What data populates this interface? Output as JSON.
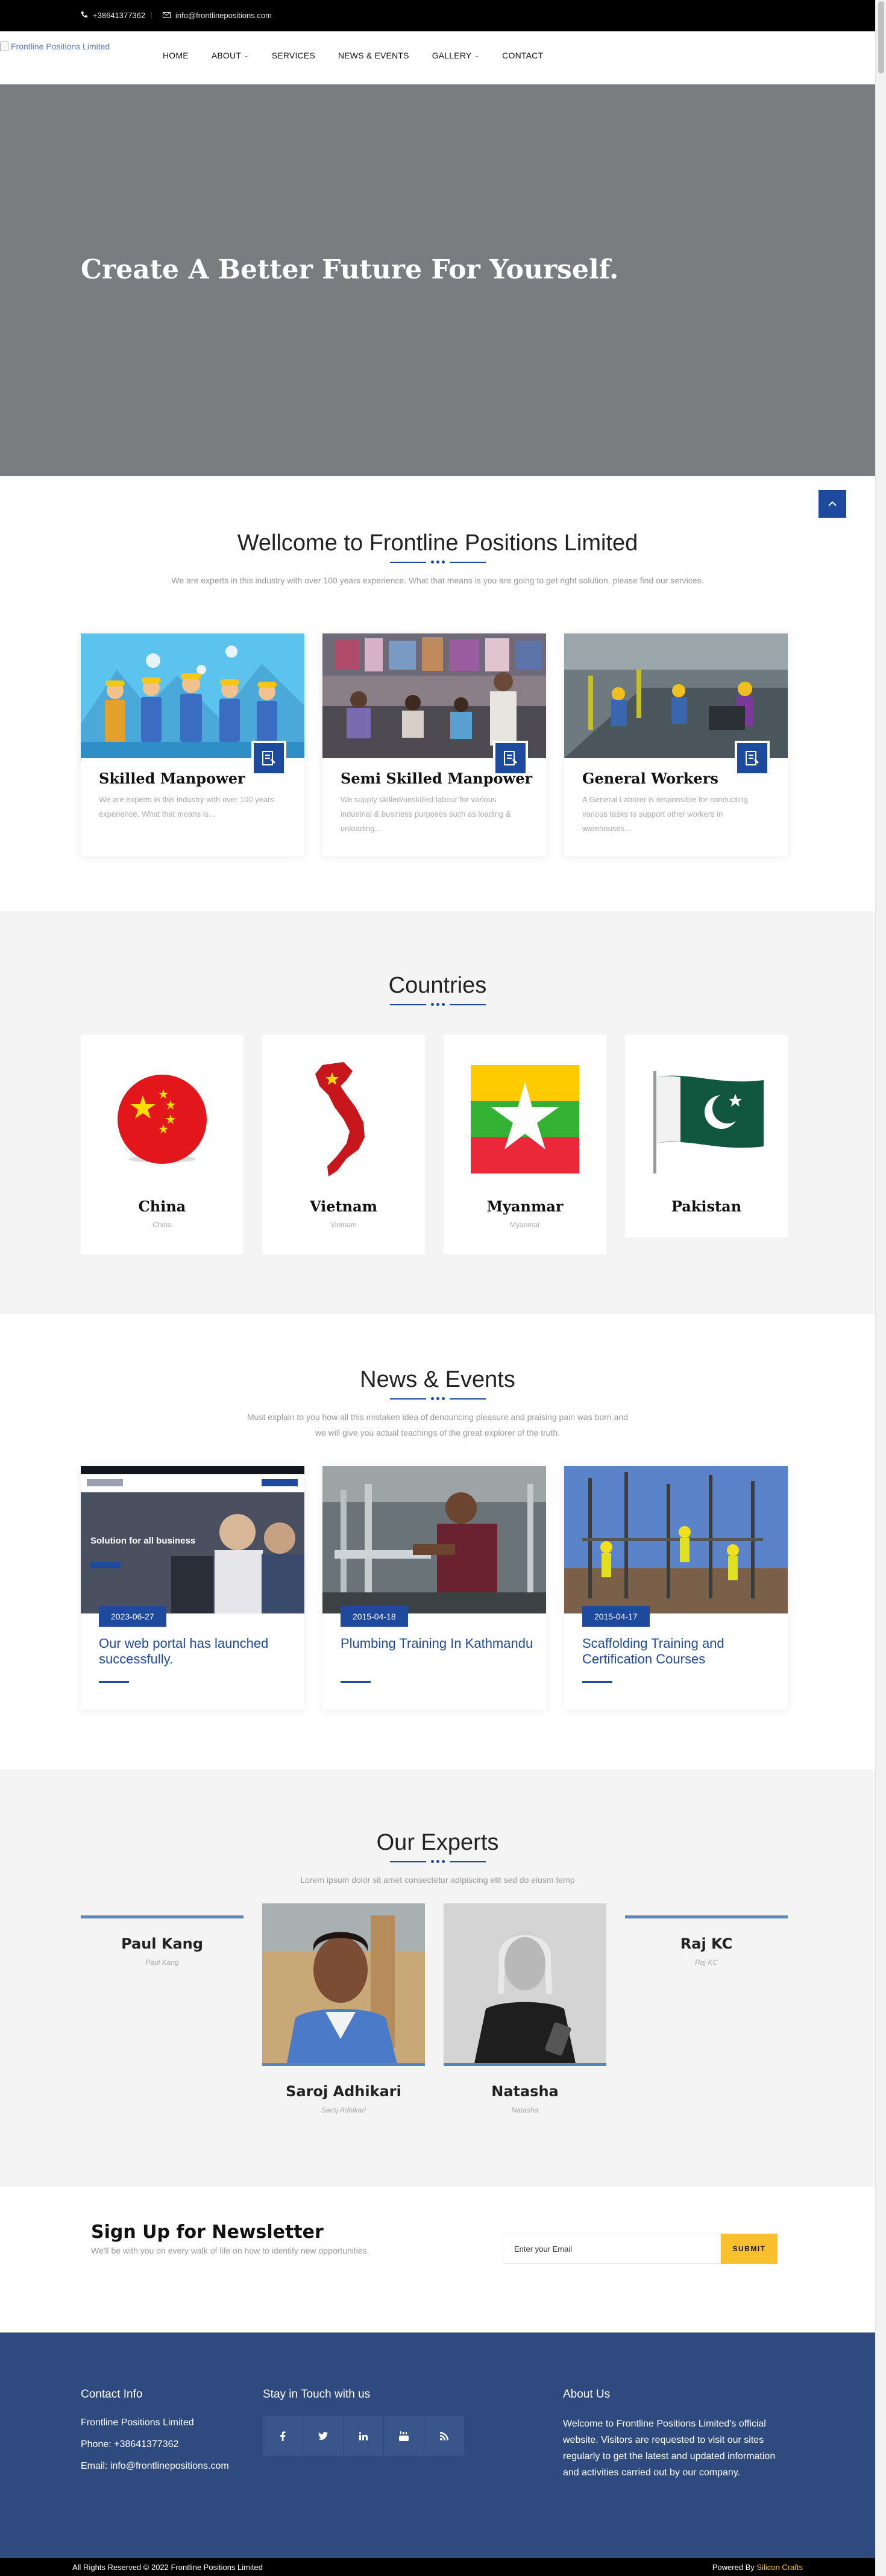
{
  "topbar": {
    "phone": "+38641377362",
    "email": "info@frontlinepositions.com"
  },
  "logo": {
    "alt": "Frontline Positions Limited"
  },
  "nav": {
    "items": [
      {
        "label": "HOME"
      },
      {
        "label": "ABOUT",
        "dropdown": true
      },
      {
        "label": "SERVICES"
      },
      {
        "label": "NEWS & EVENTS"
      },
      {
        "label": "GALLERY",
        "dropdown": true
      },
      {
        "label": "CONTACT"
      }
    ]
  },
  "hero": {
    "headline": "Create A Better Future For Yourself."
  },
  "welcome": {
    "title": "Wellcome to Frontline Positions Limited",
    "subtitle": "We are experts in this industry with over 100 years experience. What that means is you are going to get right solution. please find our services."
  },
  "services": [
    {
      "title": "Skilled Manpower",
      "text": "We are experts in this industry with over 100 years experience. What that means is..."
    },
    {
      "title": "Semi Skilled Manpower",
      "text": "We supply skilled/unskilled labour for various industrial & business purposes such as loading & unloading..."
    },
    {
      "title": "General Workers",
      "text": "A General Laborer is responsible for conducting various tasks to support other workers in warehouses..."
    }
  ],
  "countries": {
    "title": "Countries",
    "items": [
      {
        "name": "China",
        "sub": "China"
      },
      {
        "name": "Vietnam",
        "sub": "Vietnam"
      },
      {
        "name": "Myanmar",
        "sub": "Myanmar"
      },
      {
        "name": "Pakistan",
        "sub": ""
      }
    ]
  },
  "news": {
    "title": "News & Events",
    "subtitle_line1": "Must explain to you how all this mistaken idea of denouncing pleasure and praising pain was born and",
    "subtitle_line2": "we will give you actual teachings of the great explorer of the truth.",
    "items": [
      {
        "date": "2023-06-27",
        "title": "Our web portal has launched successfully.",
        "img_text": "Solution for all business"
      },
      {
        "date": "2015-04-18",
        "title": "Plumbing Training In Kathmandu"
      },
      {
        "date": "2015-04-17",
        "title": "Scaffolding Training and Certification Courses"
      }
    ]
  },
  "experts": {
    "title": "Our Experts",
    "subtitle": "Lorem ipsum dolor sit amet consectetur adipiscing elit sed do eiusm temp",
    "items": [
      {
        "name": "Paul Kang",
        "role": "Paul Kang"
      },
      {
        "name": "Saroj Adhikari",
        "role": "Saroj Adhikari"
      },
      {
        "name": "Natasha",
        "role": "Natasha"
      },
      {
        "name": "Raj KC",
        "role": "Raj KC"
      }
    ]
  },
  "newsletter": {
    "title": "Sign Up for Newsletter",
    "subtitle": "We'll be with you on every walk of life on how to identify new opportunities.",
    "placeholder": "Enter your Email",
    "button": "SUBMIT"
  },
  "footer": {
    "contact_title": "Contact Info",
    "company": "Frontline Positions Limited",
    "phone": "Phone: +38641377362",
    "email": "Email: info@frontlinepositions.com",
    "social_title": "Stay in Touch with us",
    "social_icons": [
      "facebook-icon",
      "twitter-icon",
      "linkedin-icon",
      "youtube-icon",
      "rss-icon"
    ],
    "about_title": "About Us",
    "about_text": "Welcome to Frontline Positions Limited's official website. Visitors are requested to visit our sites regularly to get the latest and updated information and activities carried out by our company."
  },
  "bottom": {
    "copyright": "All Rights Reserved © 2022 Frontline Positions Limited",
    "powered_prefix": "Powered By ",
    "powered_by": "Silicon Crafts"
  },
  "colors": {
    "primary": "#1d4a9c",
    "accent": "#f8c02d",
    "footer": "#2f4a7f",
    "hero": "#7b7c80"
  }
}
